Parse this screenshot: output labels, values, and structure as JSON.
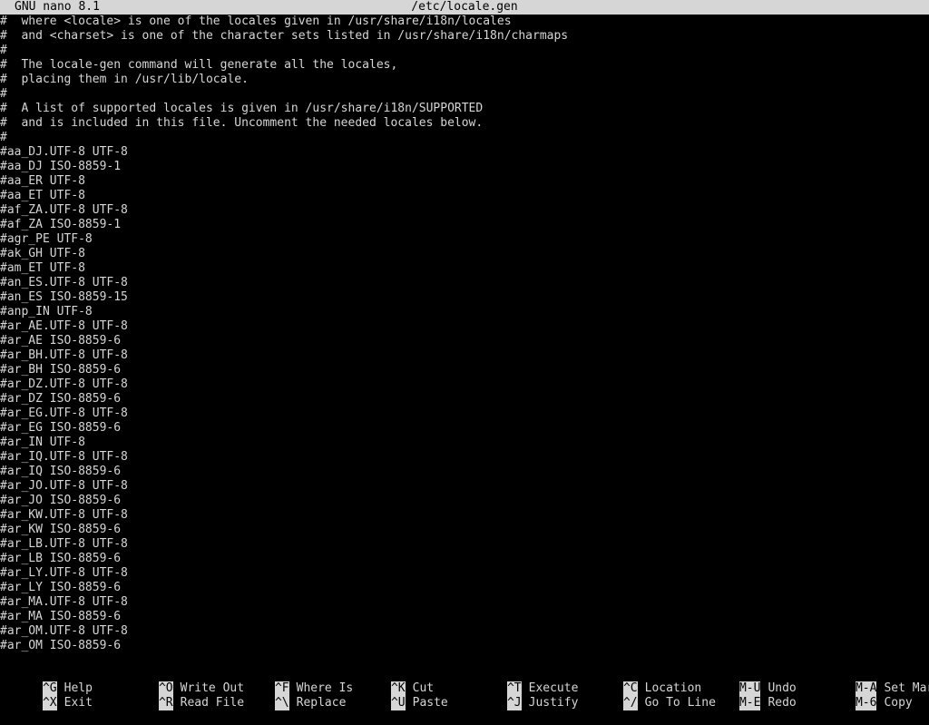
{
  "titlebar": {
    "app": "GNU nano 8.1",
    "filename": "/etc/locale.gen"
  },
  "editor": {
    "lines": [
      "#  where <locale> is one of the locales given in /usr/share/i18n/locales",
      "#  and <charset> is one of the character sets listed in /usr/share/i18n/charmaps",
      "#",
      "#  The locale-gen command will generate all the locales,",
      "#  placing them in /usr/lib/locale.",
      "#",
      "#  A list of supported locales is given in /usr/share/i18n/SUPPORTED",
      "#  and is included in this file. Uncomment the needed locales below.",
      "#",
      "#aa_DJ.UTF-8 UTF-8",
      "#aa_DJ ISO-8859-1",
      "#aa_ER UTF-8",
      "#aa_ET UTF-8",
      "#af_ZA.UTF-8 UTF-8",
      "#af_ZA ISO-8859-1",
      "#agr_PE UTF-8",
      "#ak_GH UTF-8",
      "#am_ET UTF-8",
      "#an_ES.UTF-8 UTF-8",
      "#an_ES ISO-8859-15",
      "#anp_IN UTF-8",
      "#ar_AE.UTF-8 UTF-8",
      "#ar_AE ISO-8859-6",
      "#ar_BH.UTF-8 UTF-8",
      "#ar_BH ISO-8859-6",
      "#ar_DZ.UTF-8 UTF-8",
      "#ar_DZ ISO-8859-6",
      "#ar_EG.UTF-8 UTF-8",
      "#ar_EG ISO-8859-6",
      "#ar_IN UTF-8",
      "#ar_IQ.UTF-8 UTF-8",
      "#ar_IQ ISO-8859-6",
      "#ar_JO.UTF-8 UTF-8",
      "#ar_JO ISO-8859-6",
      "#ar_KW.UTF-8 UTF-8",
      "#ar_KW ISO-8859-6",
      "#ar_LB.UTF-8 UTF-8",
      "#ar_LB ISO-8859-6",
      "#ar_LY.UTF-8 UTF-8",
      "#ar_LY ISO-8859-6",
      "#ar_MA.UTF-8 UTF-8",
      "#ar_MA ISO-8859-6",
      "#ar_OM.UTF-8 UTF-8",
      "#ar_OM ISO-8859-6"
    ]
  },
  "shortcuts": {
    "row1": [
      {
        "key": "^G",
        "label": "Help"
      },
      {
        "key": "^O",
        "label": "Write Out"
      },
      {
        "key": "^F",
        "label": "Where Is"
      },
      {
        "key": "^K",
        "label": "Cut"
      },
      {
        "key": "^T",
        "label": "Execute"
      },
      {
        "key": "^C",
        "label": "Location"
      },
      {
        "key": "M-U",
        "label": "Undo"
      },
      {
        "key": "M-A",
        "label": "Set Mark"
      }
    ],
    "row2": [
      {
        "key": "^X",
        "label": "Exit"
      },
      {
        "key": "^R",
        "label": "Read File"
      },
      {
        "key": "^\\",
        "label": "Replace"
      },
      {
        "key": "^U",
        "label": "Paste"
      },
      {
        "key": "^J",
        "label": "Justify"
      },
      {
        "key": "^/",
        "label": "Go To Line"
      },
      {
        "key": "M-E",
        "label": "Redo"
      },
      {
        "key": "M-6",
        "label": "Copy"
      }
    ]
  },
  "colors": {
    "background": "#000000",
    "foreground": "#d6d6d6",
    "inverse_bg": "#d6d6d6",
    "inverse_fg": "#000000"
  }
}
